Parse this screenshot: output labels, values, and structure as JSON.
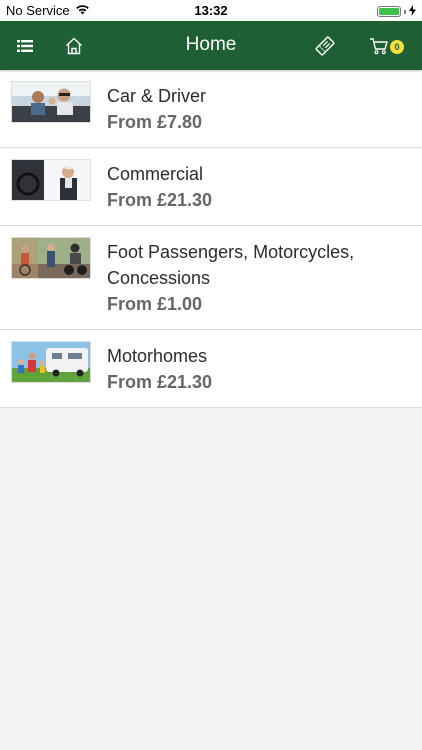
{
  "status_bar": {
    "carrier": "No Service",
    "time": "13:32"
  },
  "nav": {
    "title": "Home",
    "cart_count": "0"
  },
  "items": [
    {
      "title": "Car & Driver",
      "price": "From £7.80"
    },
    {
      "title": "Commercial",
      "price": "From £21.30"
    },
    {
      "title": "Foot Passengers, Motorcycles, Concessions",
      "price": "From £1.00"
    },
    {
      "title": "Motorhomes",
      "price": "From £21.30"
    }
  ],
  "colors": {
    "nav_green": "#1e5f33",
    "badge_yellow": "#f6df3a",
    "battery_green": "#3dc34a"
  }
}
